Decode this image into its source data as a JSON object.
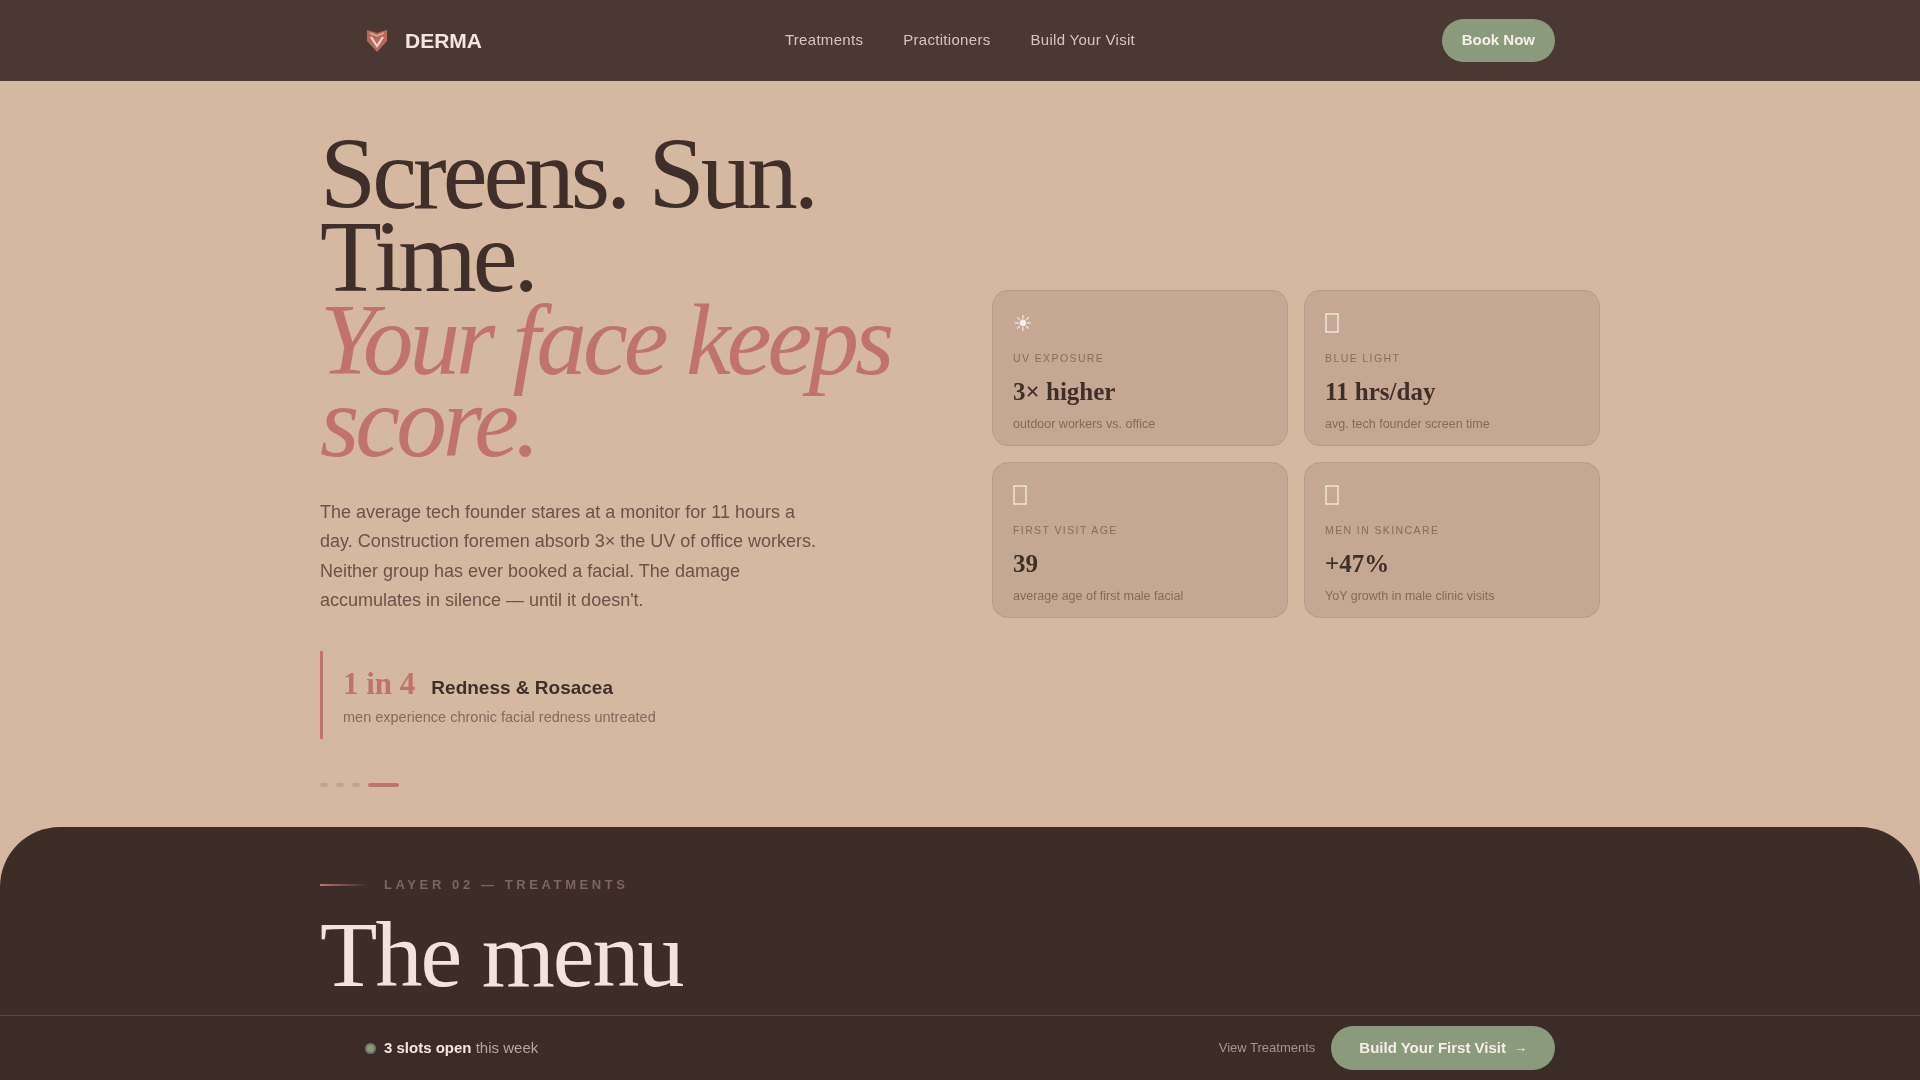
{
  "brand": {
    "name": "DERMA"
  },
  "nav": {
    "links": [
      {
        "label": "Treatments"
      },
      {
        "label": "Practitioners"
      },
      {
        "label": "Build Your Visit"
      }
    ],
    "cta": "Book Now"
  },
  "hero": {
    "headline": "Screens. Sun. Time.",
    "headline_accent": "Your face keeps score.",
    "body": "The average tech founder stares at a monitor for 11 hours a day. Construction foremen absorb 3× the UV of office workers. Neither group has ever booked a facial. The damage accumulates in silence — until it doesn't.",
    "stat": {
      "figure": "1 in 4",
      "title": "Redness & Rosacea",
      "caption": "men experience chronic facial redness untreated"
    },
    "pager": [
      {
        "selected": false
      },
      {
        "selected": false
      },
      {
        "selected": false
      },
      {
        "selected": true
      }
    ]
  },
  "cards": [
    {
      "icon": "☀",
      "kind": "glyph",
      "label": "UV EXPOSURE",
      "value": "3× higher",
      "note": "outdoor workers vs. office"
    },
    {
      "kind": "missing",
      "label": "BLUE LIGHT",
      "value": "11 hrs/day",
      "note": "avg. tech founder screen time"
    },
    {
      "kind": "missing",
      "label": "FIRST VISIT AGE",
      "value": "39",
      "note": "average age of first male facial"
    },
    {
      "kind": "missing",
      "label": "MEN IN SKINCARE",
      "value": "+47%",
      "note": "YoY growth in male clinic visits"
    }
  ],
  "section": {
    "eyebrow": "LAYER 02 — TREATMENTS",
    "title": "The menu"
  },
  "bottom_bar": {
    "slots": "**3 slots open** this week",
    "link": "View Treatments",
    "cta": "Build Your First Visit",
    "cta_icon": "→"
  }
}
